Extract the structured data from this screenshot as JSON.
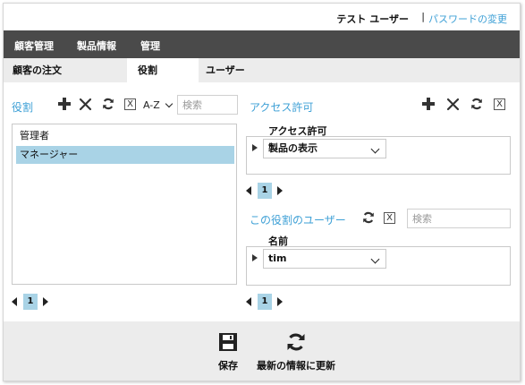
{
  "header": {
    "user_name": "テスト ユーザー",
    "separator": "|",
    "password_link": "パスワードの変更"
  },
  "main_nav": {
    "items": [
      "顧客管理",
      "製品情報",
      "管理"
    ]
  },
  "sub_tabs": {
    "items": [
      "顧客の注文",
      "役割",
      "ユーザー"
    ],
    "active_index": 1
  },
  "roles": {
    "title": "役割",
    "sort_label": "A-Z",
    "search_placeholder": "検索",
    "clear_glyph": "X",
    "items": [
      "管理者",
      "マネージャー"
    ],
    "selected_index": 1,
    "page": "1"
  },
  "permissions": {
    "title": "アクセス許可",
    "clear_glyph": "X",
    "column_header": "アクセス許可",
    "rows": [
      "製品の表示"
    ],
    "page": "1"
  },
  "role_users": {
    "title": "この役割のユーザー",
    "clear_glyph": "X",
    "search_placeholder": "検索",
    "column_header": "名前",
    "rows": [
      "tim"
    ],
    "page": "1"
  },
  "toolbar": {
    "save_label": "保存",
    "refresh_label": "最新の情報に更新"
  },
  "colors": {
    "accent": "#3ea0d6",
    "nav_bg": "#4a4a4a",
    "selected_bg": "#a9d3e6",
    "toolbar_bg": "#ececec"
  }
}
